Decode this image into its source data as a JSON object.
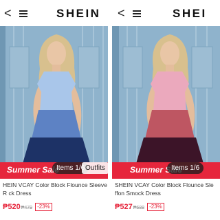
{
  "left": {
    "brand": "SHEIN",
    "back_glyph": "<",
    "sale_label": "Summer Sale",
    "items_counter": "Items 1/6",
    "outfits_label": "Outfits",
    "product_title": "HEIN VCAY Color Block Flounce Sleeve R ck Dress",
    "price": "₱520",
    "original_price": "₱479",
    "discount": "-23%",
    "dress_colors": {
      "top": "#a9c6ea",
      "middle": "#5d82c4",
      "bottom": "#1d3266"
    }
  },
  "right": {
    "brand": "SHEI",
    "back_glyph": "<",
    "sale_label": "Summer Sale",
    "items_counter": "Items 1/6",
    "product_title": "SHEIN VCAY Color Block Flounce Sle ffon Smock Dress",
    "price": "₱527",
    "original_price": "₱688",
    "discount": "-23%",
    "dress_colors": {
      "top": "#eba9bd",
      "middle": "#be5662",
      "bottom": "#3c1428"
    }
  },
  "colors": {
    "accent_red": "#e6263c",
    "door_blue": "#8fb3cc"
  },
  "icons": [
    "back-icon",
    "menu-icon"
  ]
}
